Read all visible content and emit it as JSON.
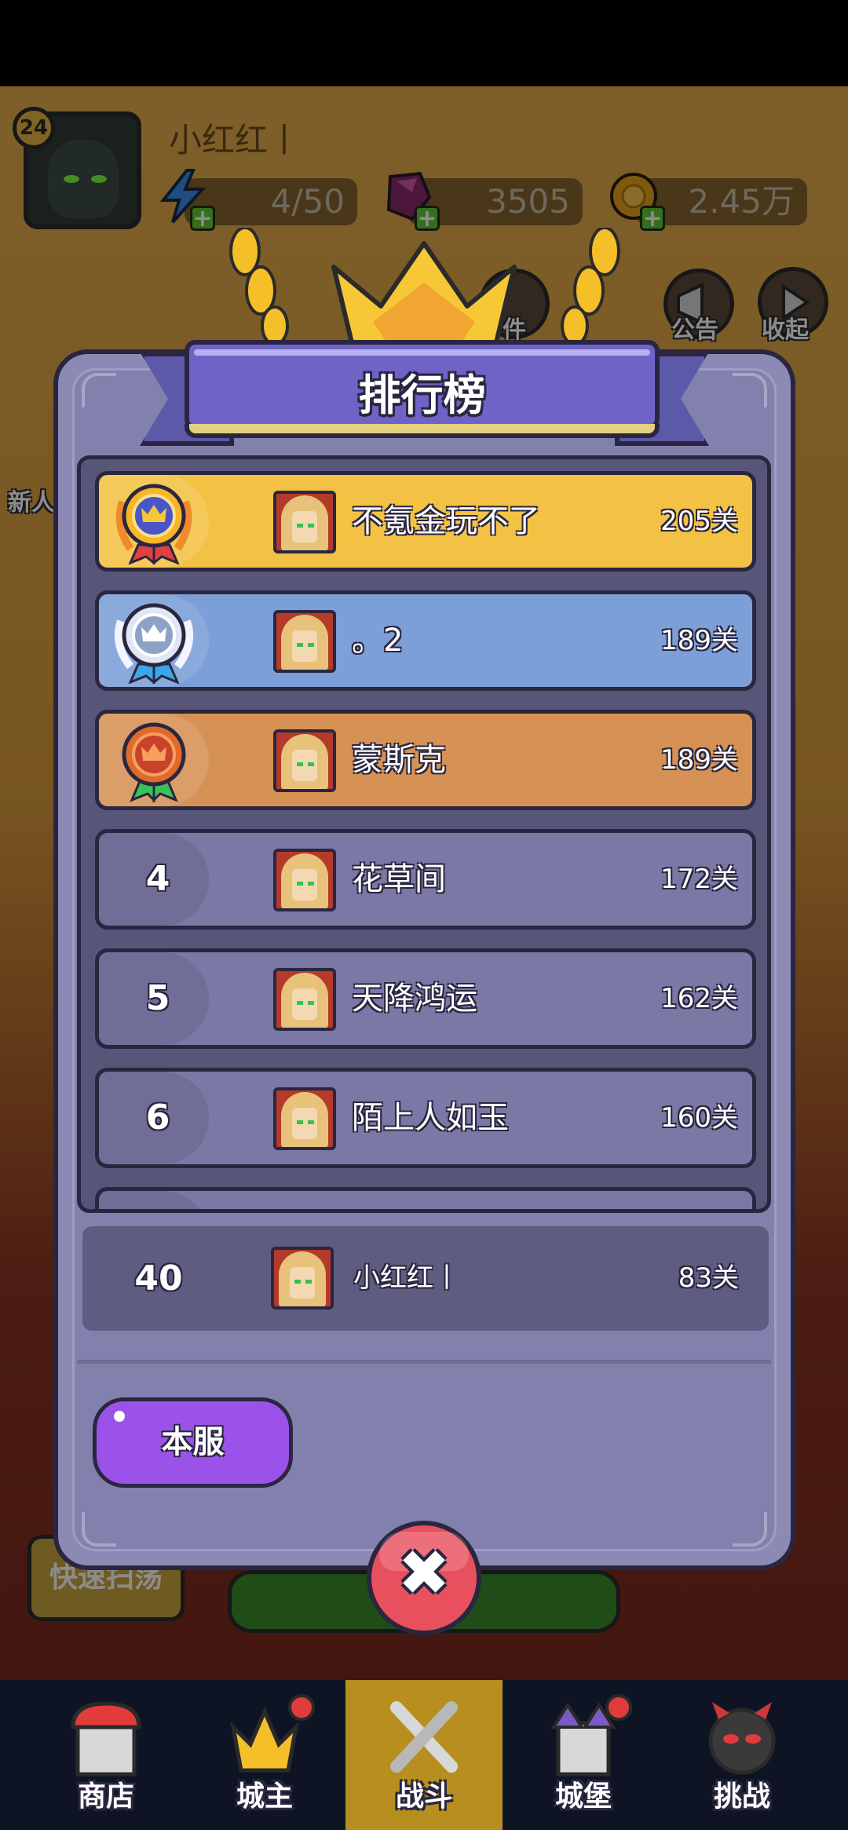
{
  "hud": {
    "level": "24",
    "player_name": "小红红丨",
    "energy": "4/50",
    "gems": "3505",
    "gold": "2.45万"
  },
  "side_buttons": {
    "mail": "件",
    "announcement": "公告",
    "collapse": "收起",
    "newbie": "新人"
  },
  "leaderboard": {
    "title": "排行榜",
    "rows": [
      {
        "rank": "1",
        "name": "不氪金玩不了",
        "score": "205关",
        "tier": "gold"
      },
      {
        "rank": "2",
        "name": "。2",
        "score": "189关",
        "tier": "silver"
      },
      {
        "rank": "3",
        "name": "蒙斯克",
        "score": "189关",
        "tier": "bronze"
      },
      {
        "rank": "4",
        "name": "花草间",
        "score": "172关",
        "tier": "normal"
      },
      {
        "rank": "5",
        "name": "天降鸿运",
        "score": "162关",
        "tier": "normal"
      },
      {
        "rank": "6",
        "name": "陌上人如玉",
        "score": "160关",
        "tier": "normal"
      }
    ],
    "my_row": {
      "rank": "40",
      "name": "小红红丨",
      "score": "83关"
    },
    "server_button": "本服"
  },
  "background": {
    "sweep_button": "快速扫荡"
  },
  "nav": {
    "shop": "商店",
    "lord": "城主",
    "battle": "战斗",
    "castle": "城堡",
    "challenge": "挑战"
  },
  "colors": {
    "panel": "#8c8ab4",
    "ribbon": "#6e64c7",
    "gold_row": "#f3c244",
    "silver_row": "#7c9fd8",
    "bronze_row": "#d69154",
    "normal_row": "#7a78a4",
    "server_button": "#9a52e8",
    "close_button": "#e8505e",
    "nav_active": "#b78f1f"
  }
}
